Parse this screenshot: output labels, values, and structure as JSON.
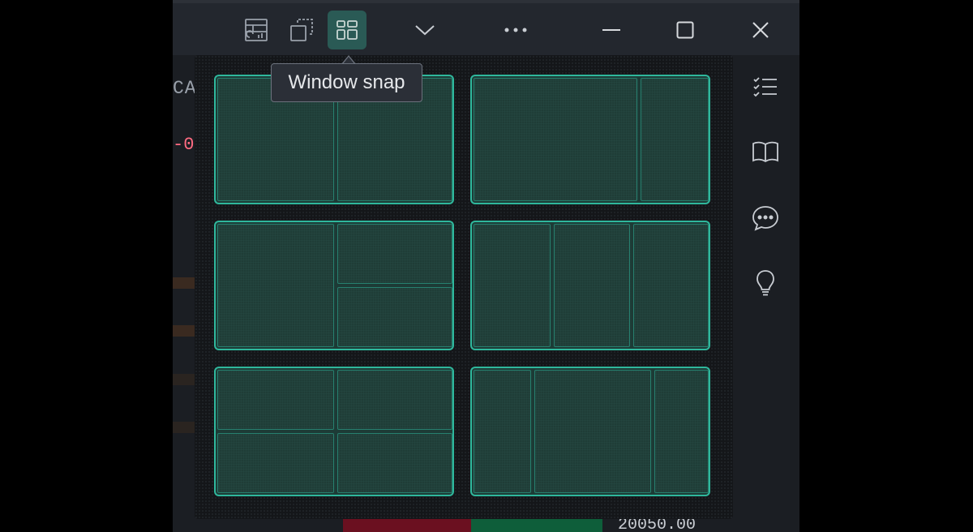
{
  "toolbar": {
    "buttons": [
      {
        "name": "layout-chart-button",
        "icon": "table-chart-icon"
      },
      {
        "name": "duplicate-window-button",
        "icon": "copy-window-icon"
      },
      {
        "name": "window-snap-button",
        "icon": "grid-layout-icon",
        "active": true
      },
      {
        "name": "dropdown-button",
        "icon": "chevron-down-icon"
      },
      {
        "name": "more-button",
        "icon": "more-horizontal-icon"
      },
      {
        "name": "minimize-button",
        "icon": "minimize-icon"
      },
      {
        "name": "maximize-button",
        "icon": "maximize-icon"
      },
      {
        "name": "close-button",
        "icon": "close-icon"
      }
    ]
  },
  "tooltip": {
    "label": "Window snap"
  },
  "snap_layouts": [
    {
      "name": "two-columns"
    },
    {
      "name": "wide-left-narrow-right"
    },
    {
      "name": "left-half-right-split"
    },
    {
      "name": "three-columns"
    },
    {
      "name": "four-quadrants"
    },
    {
      "name": "narrow-wide-narrow"
    }
  ],
  "sidebar": {
    "icons": [
      "checklist-icon",
      "book-icon",
      "chat-icon",
      "lightbulb-icon"
    ]
  },
  "background": {
    "code_text": "CAT",
    "negative_value": "-0",
    "price": "20050.00"
  },
  "colors": {
    "accent": "#2fb79c",
    "active_button": "#2a5a55",
    "panel_bg": "#141619"
  }
}
